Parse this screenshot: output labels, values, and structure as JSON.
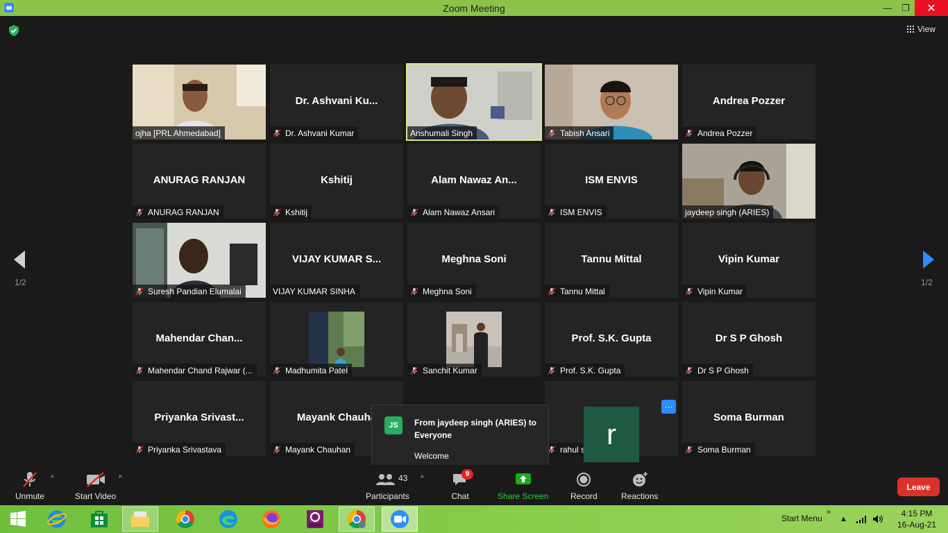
{
  "window": {
    "title": "Zoom Meeting",
    "minimize": "—",
    "maximize": "❐",
    "close": "✕"
  },
  "header": {
    "view_label": "View"
  },
  "pagination": {
    "left": "1/2",
    "right": "1/2"
  },
  "tiles": [
    {
      "display": "",
      "label": "ojha [PRL Ahmedabad]",
      "muted": false,
      "video": true
    },
    {
      "display": "Dr. Ashvani Ku...",
      "label": "Dr. Ashvani Kumar",
      "muted": true,
      "video": false
    },
    {
      "display": "",
      "label": "Anshumali Singh",
      "muted": false,
      "video": true,
      "active": true
    },
    {
      "display": "",
      "label": "Tabish Ansari",
      "muted": true,
      "video": true
    },
    {
      "display": "Andrea Pozzer",
      "label": "Andrea Pozzer",
      "muted": true,
      "video": false
    },
    {
      "display": "ANURAG RANJAN",
      "label": "ANURAG RANJAN",
      "muted": true,
      "video": false
    },
    {
      "display": "Kshitij",
      "label": "Kshitij",
      "muted": true,
      "video": false
    },
    {
      "display": "Alam Nawaz An...",
      "label": "Alam Nawaz Ansari",
      "muted": true,
      "video": false
    },
    {
      "display": "ISM ENVIS",
      "label": "ISM ENVIS",
      "muted": true,
      "video": false
    },
    {
      "display": "",
      "label": "jaydeep singh (ARIES)",
      "muted": false,
      "video": true
    },
    {
      "display": "",
      "label": "Suresh Pandian Elumalai",
      "muted": true,
      "video": true
    },
    {
      "display": "VIJAY KUMAR S...",
      "label": "VIJAY KUMAR SINHA",
      "muted": false,
      "video": false
    },
    {
      "display": "Meghna Soni",
      "label": "Meghna Soni",
      "muted": true,
      "video": false
    },
    {
      "display": "Tannu Mittal",
      "label": "Tannu Mittal",
      "muted": true,
      "video": false
    },
    {
      "display": "Vipin Kumar",
      "label": "Vipin Kumar",
      "muted": true,
      "video": false
    },
    {
      "display": "Mahendar  Chan...",
      "label": "Mahendar Chand Rajwar (...",
      "muted": true,
      "video": false
    },
    {
      "display": "",
      "label": "Madhumita Patel",
      "muted": true,
      "video": false,
      "photo": true
    },
    {
      "display": "",
      "label": "Sanchit Kumar",
      "muted": true,
      "video": false,
      "photo": true
    },
    {
      "display": "Prof. S.K. Gupta",
      "label": "Prof. S.K. Gupta",
      "muted": true,
      "video": false
    },
    {
      "display": "Dr S P Ghosh",
      "label": "Dr S P Ghosh",
      "muted": true,
      "video": false
    },
    {
      "display": "Priyanka  Srivast...",
      "label": "Priyanka Srivastava",
      "muted": true,
      "video": false
    },
    {
      "display": "Mayank Chauha",
      "label": "Mayank Chauhan",
      "muted": true,
      "video": false
    },
    {
      "display": "",
      "label": "",
      "muted": false,
      "video": false,
      "hidden": true
    },
    {
      "display": "",
      "label": "rahul sheoran",
      "muted": true,
      "video": false,
      "avatar": "r"
    },
    {
      "display": "Soma Burman",
      "label": "Soma Burman",
      "muted": true,
      "video": false
    }
  ],
  "chat_popup": {
    "initials": "JS",
    "from": "From jaydeep singh (ARIES) to Everyone",
    "message": "Welcome"
  },
  "tile_more": "···",
  "toolbar": {
    "unmute": "Unmute",
    "start_video": "Start Video",
    "participants": "Participants",
    "participants_count": "43",
    "chat": "Chat",
    "chat_badge": "9",
    "share_screen": "Share Screen",
    "record": "Record",
    "reactions": "Reactions",
    "leave": "Leave",
    "caret": "^"
  },
  "taskbar": {
    "start_menu": "Start Menu",
    "tray_chevron": "»",
    "clock_time": "4:15 PM",
    "clock_date": "16-Aug-21"
  },
  "colors": {
    "accent_green": "#8bc34a",
    "active_speaker": "#d9e88a",
    "leave_red": "#d9312b",
    "share_green": "#1aad19",
    "zoom_blue": "#2d8cff"
  }
}
